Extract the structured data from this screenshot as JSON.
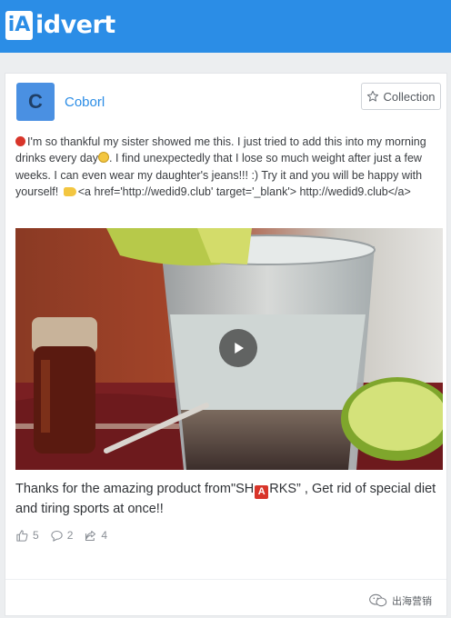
{
  "brand": {
    "logo_mark": "iA",
    "logo_text": "idvert",
    "color": "#2b8de6"
  },
  "post": {
    "avatar_letter": "C",
    "username": "Coborl",
    "collection_label": "Collection",
    "text_part1": "I'm so thankful my sister showed me this. I just tried to add this into my morning drinks every day",
    "text_part2": ". I find unexpectedly that I lose so much weight after just a few weeks. I can even wear my daughter's jeans!!! :) Try it and you will be happy with yourself!",
    "text_part3": "<a href='http://wedid9.club' target='_blank'> http://wedid9.club</a>",
    "caption_part1": "Thanks for the amazing product from\"SH",
    "caption_emoji": "A",
    "caption_part2": "RKS” , Get rid of special diet and tiring sports at once!!",
    "likes": "5",
    "comments": "2",
    "shares": "4"
  },
  "watermark": {
    "text": "出海营销"
  },
  "icons": [
    "star-icon",
    "play-icon",
    "thumbs-up-icon",
    "comment-icon",
    "share-icon",
    "wechat-icon"
  ]
}
